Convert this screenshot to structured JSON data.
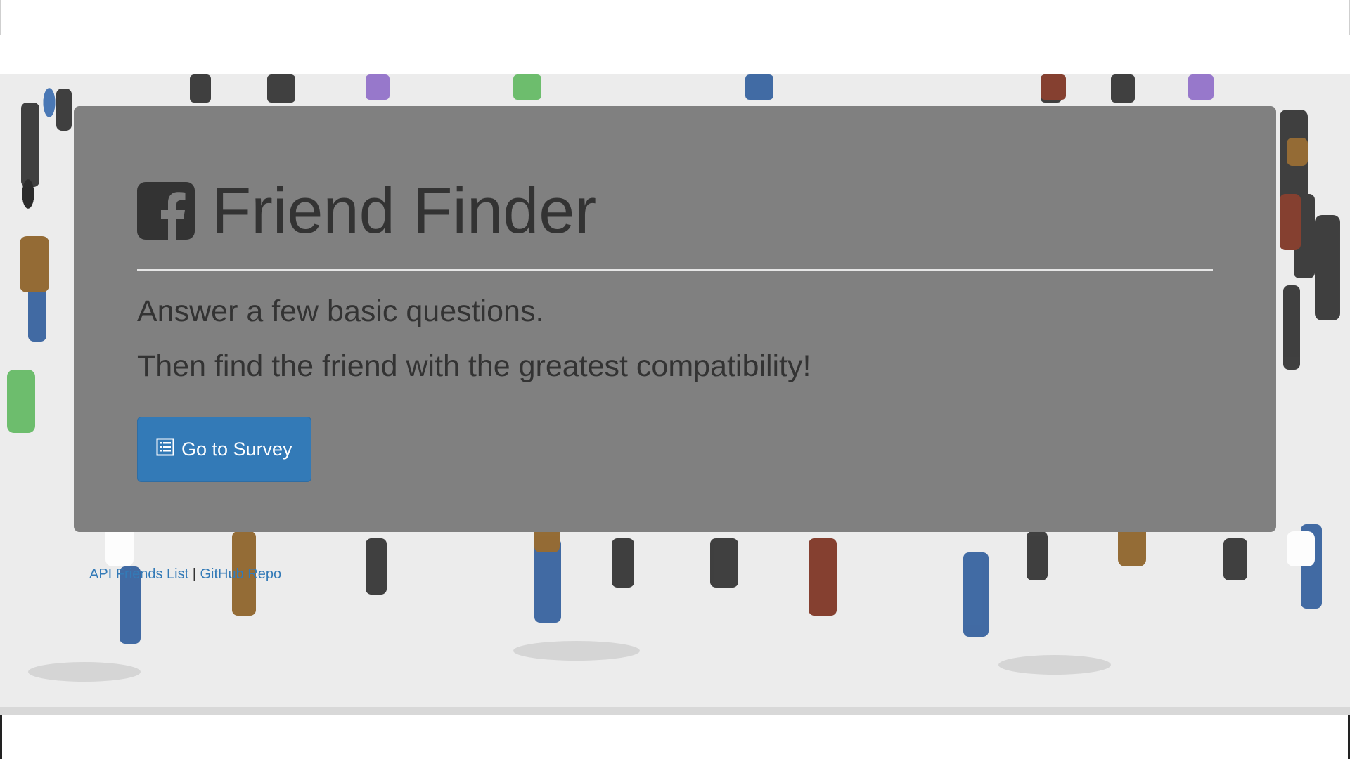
{
  "page": {
    "title": "Friend Finder",
    "lead_1": "Answer a few basic questions.",
    "lead_2": "Then find the friend with the greatest compatibility!",
    "survey_button_label": "Go to Survey",
    "brand_icon": "facebook-square-icon",
    "button_icon": "list-alt-icon"
  },
  "footer": {
    "link_friends": "API Friends List",
    "separator": "|",
    "link_repo": "GitHub Repo"
  },
  "colors": {
    "jumbotron_bg": "#808080",
    "text_dark": "#333333",
    "button_primary": "#337ab7",
    "link": "#337ab7",
    "background_pattern": "crowd-of-people-illustration"
  }
}
